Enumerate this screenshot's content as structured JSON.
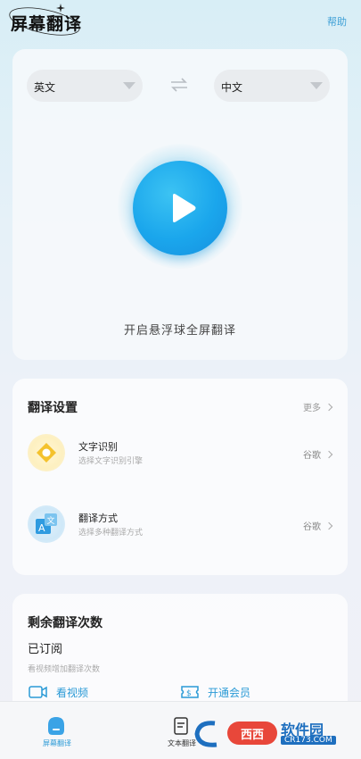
{
  "header": {
    "title": "屏幕翻译",
    "help_label": "帮助"
  },
  "translate": {
    "source_lang": "英文",
    "target_lang": "中文",
    "start_label": "开启悬浮球全屏翻译"
  },
  "settings": {
    "title": "翻译设置",
    "more_label": "更多",
    "items": [
      {
        "title": "文字识别",
        "subtitle": "选择文字识别引擎",
        "value": "谷歌",
        "icon": "ocr-icon"
      },
      {
        "title": "翻译方式",
        "subtitle": "选择多种翻译方式",
        "value": "谷歌",
        "icon": "translate-method-icon"
      }
    ]
  },
  "quota": {
    "title": "剩余翻译次数",
    "status": "已订阅",
    "hint": "看视频增加翻译次数",
    "actions": [
      {
        "label": "看视频",
        "icon": "video-icon"
      },
      {
        "label": "开通会员",
        "icon": "membership-icon"
      }
    ]
  },
  "nav": {
    "items": [
      {
        "label": "屏幕翻译",
        "icon": "screen-translate-icon",
        "active": true
      },
      {
        "label": "文本翻译",
        "icon": "text-translate-icon",
        "active": false
      }
    ]
  },
  "watermark": {
    "badge": "西西",
    "name": "软件园",
    "url": "CR173.COM"
  },
  "colors": {
    "accent": "#2a9ad6",
    "play": "#1aa6ec",
    "watermark_red": "#e8473a",
    "watermark_blue": "#1e6fbf"
  }
}
